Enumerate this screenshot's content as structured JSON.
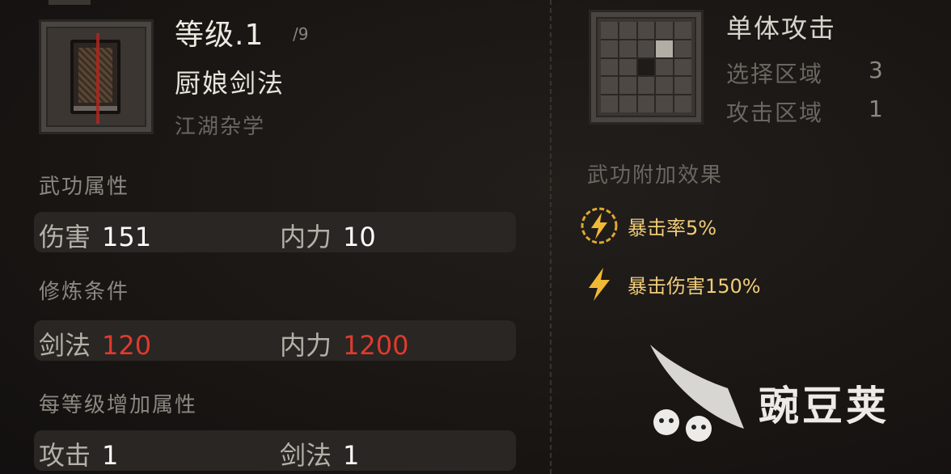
{
  "skill": {
    "level_label": "等级.1",
    "max_level": "/9",
    "name": "厨娘剑法",
    "category": "江湖杂学",
    "icon": "book-icon"
  },
  "sections": {
    "attributes_title": "武功属性",
    "requirements_title": "修炼条件",
    "per_level_title": "每等级增加属性"
  },
  "attributes": [
    {
      "label": "伤害",
      "value": "151"
    },
    {
      "label": "内力",
      "value": "10"
    }
  ],
  "requirements": [
    {
      "label": "剑法",
      "value": "120"
    },
    {
      "label": "内力",
      "value": "1200"
    }
  ],
  "per_level": [
    {
      "label": "攻击",
      "value": "1"
    },
    {
      "label": "剑法",
      "value": "1"
    }
  ],
  "attack": {
    "type": "单体攻击",
    "select_area_label": "选择区域",
    "select_area_value": "3",
    "attack_area_label": "攻击区域",
    "attack_area_value": "1"
  },
  "effects": {
    "title": "武功附加效果",
    "items": [
      {
        "text": "暴击率5%",
        "icon": "lightning-circle-icon"
      },
      {
        "text": "暴击伤害150%",
        "icon": "lightning-icon"
      }
    ]
  },
  "watermark": {
    "text": "豌豆荚",
    "icon": "pea-pod-logo"
  },
  "colors": {
    "requirement_value": "#e03a2e",
    "effect_text": "#f0cc7a",
    "background": "#1a1715"
  }
}
